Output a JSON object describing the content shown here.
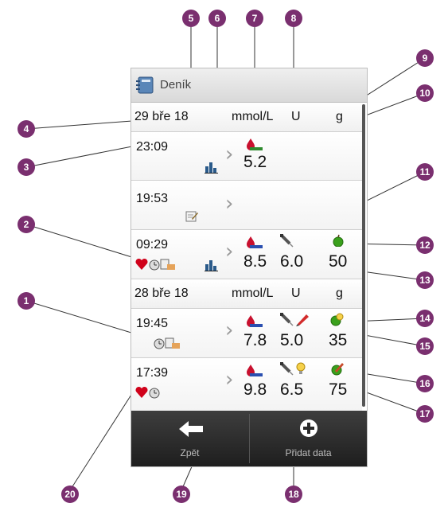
{
  "window": {
    "title": "Deník"
  },
  "days": [
    {
      "date": "29 bře 18",
      "unit_glucose": "mmol/L",
      "unit_insulin": "U",
      "unit_carbs": "g"
    },
    {
      "date": "28 bře 18",
      "unit_glucose": "mmol/L",
      "unit_insulin": "U",
      "unit_carbs": "g"
    }
  ],
  "entries": [
    {
      "time": "23:09",
      "glucose": "5.2",
      "insulin": "",
      "carbs": ""
    },
    {
      "time": "19:53",
      "glucose": "",
      "insulin": "",
      "carbs": ""
    },
    {
      "time": "09:29",
      "glucose": "8.5",
      "insulin": "6.0",
      "carbs": "50"
    },
    {
      "time": "19:45",
      "glucose": "7.8",
      "insulin": "5.0",
      "carbs": "35"
    },
    {
      "time": "17:39",
      "glucose": "9.8",
      "insulin": "6.5",
      "carbs": "75"
    }
  ],
  "toolbar": {
    "back_label": "Zpět",
    "add_label": "Přidat data"
  },
  "callouts": [
    "1",
    "2",
    "3",
    "4",
    "5",
    "6",
    "7",
    "8",
    "9",
    "10",
    "11",
    "12",
    "13",
    "14",
    "15",
    "16",
    "17",
    "18",
    "19",
    "20"
  ],
  "colors": {
    "callout": "#7a2f6f",
    "glucose_drop": "#c8102e",
    "apple": "#3aa01c",
    "heart": "#d0021b"
  }
}
